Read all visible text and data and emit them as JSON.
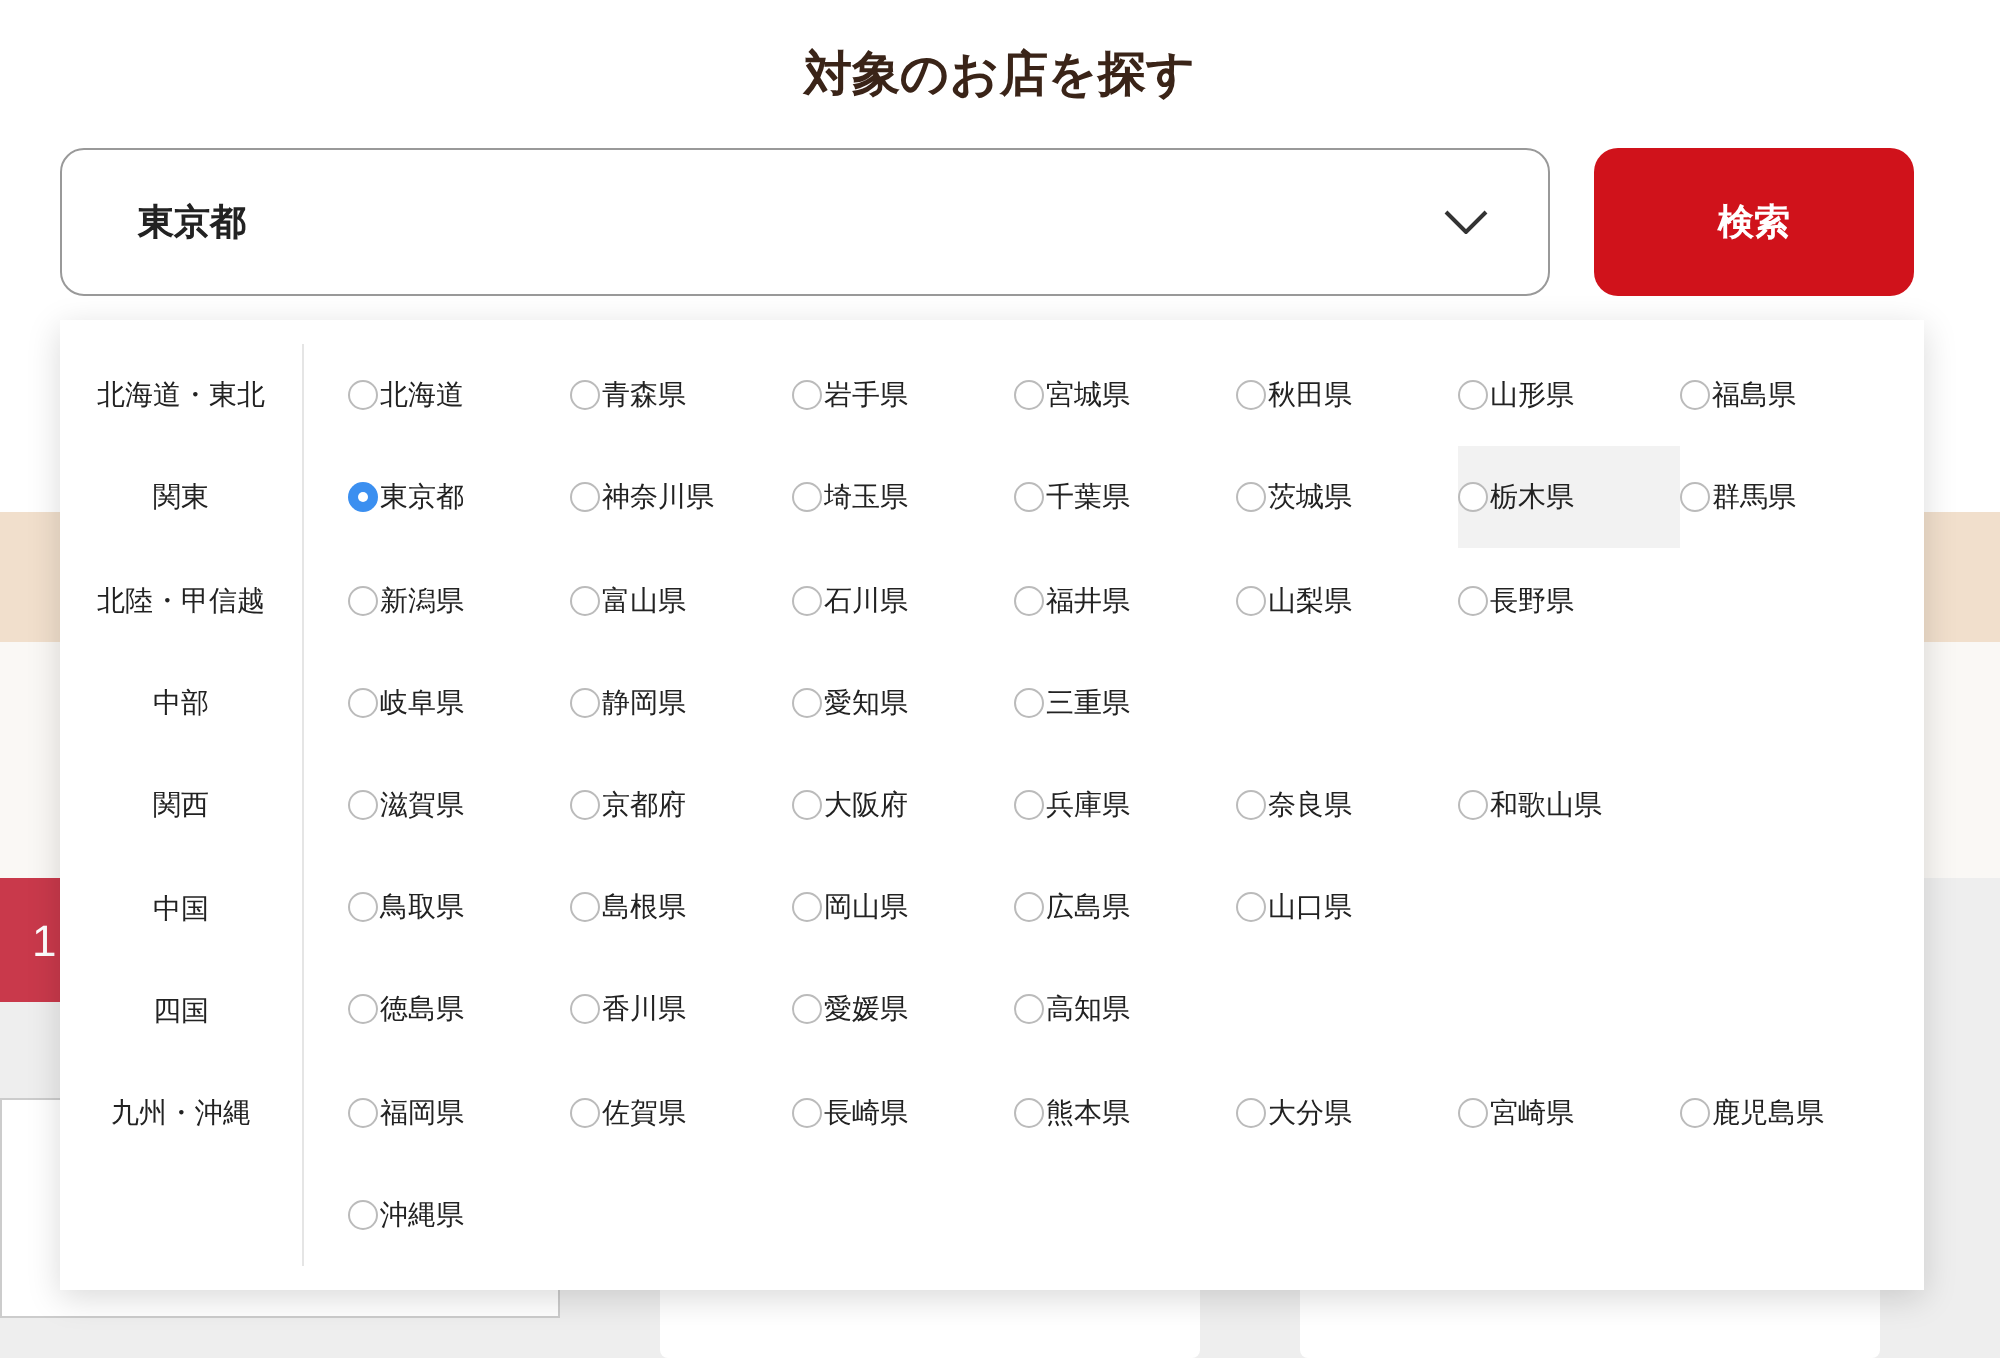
{
  "title": "対象のお店を探す",
  "select": {
    "value": "東京都",
    "expanded": true
  },
  "search_button": "検索",
  "regions": [
    {
      "label": "北海道・東北"
    },
    {
      "label": "関東"
    },
    {
      "label": "北陸・甲信越"
    },
    {
      "label": "中部"
    },
    {
      "label": "関西"
    },
    {
      "label": "中国"
    },
    {
      "label": "四国"
    },
    {
      "label": "九州・沖縄"
    }
  ],
  "prefecture_rows": [
    [
      {
        "name": "北海道",
        "selected": false,
        "highlighted": false
      },
      {
        "name": "青森県",
        "selected": false,
        "highlighted": false
      },
      {
        "name": "岩手県",
        "selected": false,
        "highlighted": false
      },
      {
        "name": "宮城県",
        "selected": false,
        "highlighted": false
      },
      {
        "name": "秋田県",
        "selected": false,
        "highlighted": false
      },
      {
        "name": "山形県",
        "selected": false,
        "highlighted": false
      },
      {
        "name": "福島県",
        "selected": false,
        "highlighted": false
      }
    ],
    [
      {
        "name": "東京都",
        "selected": true,
        "highlighted": false
      },
      {
        "name": "神奈川県",
        "selected": false,
        "highlighted": false
      },
      {
        "name": "埼玉県",
        "selected": false,
        "highlighted": false
      },
      {
        "name": "千葉県",
        "selected": false,
        "highlighted": false
      },
      {
        "name": "茨城県",
        "selected": false,
        "highlighted": false
      },
      {
        "name": "栃木県",
        "selected": false,
        "highlighted": true
      },
      {
        "name": "群馬県",
        "selected": false,
        "highlighted": false
      }
    ],
    [
      {
        "name": "新潟県",
        "selected": false,
        "highlighted": false
      },
      {
        "name": "富山県",
        "selected": false,
        "highlighted": false
      },
      {
        "name": "石川県",
        "selected": false,
        "highlighted": false
      },
      {
        "name": "福井県",
        "selected": false,
        "highlighted": false
      },
      {
        "name": "山梨県",
        "selected": false,
        "highlighted": false
      },
      {
        "name": "長野県",
        "selected": false,
        "highlighted": false
      }
    ],
    [
      {
        "name": "岐阜県",
        "selected": false,
        "highlighted": false
      },
      {
        "name": "静岡県",
        "selected": false,
        "highlighted": false
      },
      {
        "name": "愛知県",
        "selected": false,
        "highlighted": false
      },
      {
        "name": "三重県",
        "selected": false,
        "highlighted": false
      }
    ],
    [
      {
        "name": "滋賀県",
        "selected": false,
        "highlighted": false
      },
      {
        "name": "京都府",
        "selected": false,
        "highlighted": false
      },
      {
        "name": "大阪府",
        "selected": false,
        "highlighted": false
      },
      {
        "name": "兵庫県",
        "selected": false,
        "highlighted": false
      },
      {
        "name": "奈良県",
        "selected": false,
        "highlighted": false
      },
      {
        "name": "和歌山県",
        "selected": false,
        "highlighted": false
      }
    ],
    [
      {
        "name": "鳥取県",
        "selected": false,
        "highlighted": false
      },
      {
        "name": "島根県",
        "selected": false,
        "highlighted": false
      },
      {
        "name": "岡山県",
        "selected": false,
        "highlighted": false
      },
      {
        "name": "広島県",
        "selected": false,
        "highlighted": false
      },
      {
        "name": "山口県",
        "selected": false,
        "highlighted": false
      }
    ],
    [
      {
        "name": "徳島県",
        "selected": false,
        "highlighted": false
      },
      {
        "name": "香川県",
        "selected": false,
        "highlighted": false
      },
      {
        "name": "愛媛県",
        "selected": false,
        "highlighted": false
      },
      {
        "name": "高知県",
        "selected": false,
        "highlighted": false
      }
    ],
    [
      {
        "name": "福岡県",
        "selected": false,
        "highlighted": false
      },
      {
        "name": "佐賀県",
        "selected": false,
        "highlighted": false
      },
      {
        "name": "長崎県",
        "selected": false,
        "highlighted": false
      },
      {
        "name": "熊本県",
        "selected": false,
        "highlighted": false
      },
      {
        "name": "大分県",
        "selected": false,
        "highlighted": false
      },
      {
        "name": "宮崎県",
        "selected": false,
        "highlighted": false
      },
      {
        "name": "鹿児島県",
        "selected": false,
        "highlighted": false
      }
    ],
    [
      {
        "name": "沖縄県",
        "selected": false,
        "highlighted": false
      }
    ]
  ],
  "ranking_badge": "1"
}
